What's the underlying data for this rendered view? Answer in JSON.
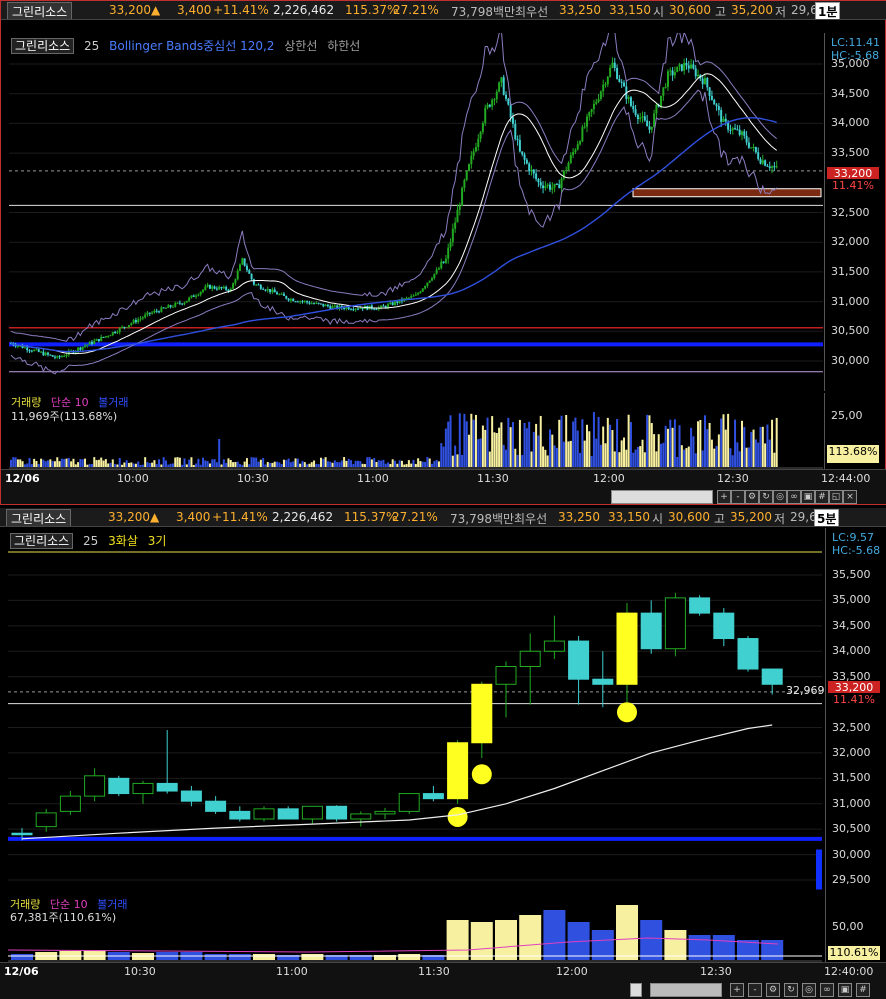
{
  "quote": {
    "symbol": "그린리소스",
    "price": "33,200",
    "arrow": "▲",
    "change": "3,400",
    "change_pct": "+11.41%",
    "volume": "2,226,462",
    "vol_ratio": "115.37%",
    "turnover": "27.21%",
    "amount": "73,798백만",
    "best_label": "최우선",
    "ask": "33,250",
    "bid": "33,150",
    "open_label": "시",
    "open": "30,600",
    "high_label": "고",
    "high": "35,200",
    "low_label": "저",
    "low": "29,6"
  },
  "top_chart": {
    "timeframe": "1분",
    "legend": {
      "symbol": "그린리소스",
      "period": "25",
      "indicator": "Bollinger Bands",
      "mid": "중심선 120,2",
      "upper": "상한선",
      "lower": "하한선"
    },
    "lc": "LC:11.41",
    "hc": "HC:-5.68",
    "y_ticks": [
      "35,000",
      "34,500",
      "34,000",
      "33,500",
      "32,500",
      "32,000",
      "31,500",
      "31,000",
      "30,500",
      "30,000"
    ],
    "price_tag": "33,200",
    "pct_tag": "11.41%",
    "volume_legend": {
      "label": "거래량",
      "ma": "단순 10",
      "extra": "볼거래",
      "value": "11,969주(113.68%)"
    },
    "vol_axis": "25,00",
    "vol_tag": "113.68%",
    "x_ticks": [
      "12/06",
      "10:00",
      "10:30",
      "11:00",
      "11:30",
      "12:00",
      "12:30",
      "12:44:00"
    ]
  },
  "bottom_chart": {
    "timeframe": "5분",
    "legend": {
      "symbol": "그린리소스",
      "period": "25",
      "pattern": "3화살",
      "count": "3기"
    },
    "lc": "LC:9.57",
    "hc": "HC:-5.68",
    "y_ticks": [
      "35,500",
      "35,000",
      "34,500",
      "34,000",
      "33,500",
      "32,500",
      "32,000",
      "31,500",
      "31,000",
      "30,500",
      "30,000",
      "29,500"
    ],
    "price_tag": "33,200",
    "pct_tag": "11.41%",
    "line_label": "32,969",
    "volume_legend": {
      "label": "거래량",
      "ma": "단순 10",
      "extra": "볼거래",
      "value": "67,381주(110.61%)"
    },
    "vol_axis": "50,00",
    "vol_tag": "110.61%",
    "x_ticks": [
      "12/06",
      "10:30",
      "11:00",
      "11:30",
      "12:00",
      "12:30",
      "12:40:00"
    ]
  },
  "candles5": [
    {
      "o": 30420,
      "h": 30520,
      "l": 30280,
      "c": 30400
    },
    {
      "o": 30550,
      "h": 30900,
      "l": 30450,
      "c": 30820
    },
    {
      "o": 30850,
      "h": 31250,
      "l": 30780,
      "c": 31150
    },
    {
      "o": 31150,
      "h": 31700,
      "l": 31050,
      "c": 31550
    },
    {
      "o": 31500,
      "h": 31550,
      "l": 31150,
      "c": 31200
    },
    {
      "o": 31200,
      "h": 31450,
      "l": 31000,
      "c": 31400
    },
    {
      "o": 31400,
      "h": 32450,
      "l": 31200,
      "c": 31250
    },
    {
      "o": 31250,
      "h": 31350,
      "l": 30950,
      "c": 31050
    },
    {
      "o": 31050,
      "h": 31150,
      "l": 30800,
      "c": 30850
    },
    {
      "o": 30850,
      "h": 30950,
      "l": 30650,
      "c": 30700
    },
    {
      "o": 30700,
      "h": 30950,
      "l": 30650,
      "c": 30900
    },
    {
      "o": 30900,
      "h": 30950,
      "l": 30700,
      "c": 30700
    },
    {
      "o": 30700,
      "h": 30950,
      "l": 30600,
      "c": 30950
    },
    {
      "o": 30950,
      "h": 30970,
      "l": 30650,
      "c": 30700
    },
    {
      "o": 30700,
      "h": 30850,
      "l": 30550,
      "c": 30800
    },
    {
      "o": 30800,
      "h": 30920,
      "l": 30700,
      "c": 30850
    },
    {
      "o": 30850,
      "h": 31200,
      "l": 30800,
      "c": 31200
    },
    {
      "o": 31200,
      "h": 31350,
      "l": 31050,
      "c": 31100
    },
    {
      "o": 31100,
      "h": 32250,
      "l": 31000,
      "c": 32200
    },
    {
      "o": 32200,
      "h": 33400,
      "l": 31900,
      "c": 33350
    },
    {
      "o": 33350,
      "h": 33800,
      "l": 32700,
      "c": 33700
    },
    {
      "o": 33700,
      "h": 34350,
      "l": 32950,
      "c": 34000
    },
    {
      "o": 34000,
      "h": 34700,
      "l": 33850,
      "c": 34200
    },
    {
      "o": 34200,
      "h": 34300,
      "l": 32950,
      "c": 33450
    },
    {
      "o": 33450,
      "h": 34000,
      "l": 32900,
      "c": 33350
    },
    {
      "o": 33350,
      "h": 34950,
      "l": 33000,
      "c": 34750
    },
    {
      "o": 34750,
      "h": 35000,
      "l": 33950,
      "c": 34050
    },
    {
      "o": 34050,
      "h": 35150,
      "l": 33900,
      "c": 35050
    },
    {
      "o": 35050,
      "h": 35100,
      "l": 34700,
      "c": 34750
    },
    {
      "o": 34750,
      "h": 34850,
      "l": 34100,
      "c": 34250
    },
    {
      "o": 34250,
      "h": 34300,
      "l": 33600,
      "c": 33650
    },
    {
      "o": 33650,
      "h": 33650,
      "l": 33150,
      "c": 33350
    }
  ],
  "vol5": [
    6,
    8,
    9,
    10,
    8,
    7,
    8,
    8,
    6,
    6,
    6,
    5,
    6,
    5,
    5,
    5,
    6,
    5,
    40,
    38,
    40,
    45,
    50,
    38,
    30,
    55,
    40,
    30,
    25,
    25,
    20,
    20
  ],
  "vol5_types": [
    "b",
    "y",
    "y",
    "y",
    "b",
    "y",
    "b",
    "b",
    "b",
    "b",
    "y",
    "b",
    "y",
    "b",
    "b",
    "y",
    "y",
    "b",
    "y",
    "y",
    "y",
    "y",
    "b",
    "b",
    "b",
    "y",
    "b",
    "y",
    "b",
    "b",
    "b",
    "b"
  ],
  "markers": [
    {
      "i": 18,
      "price": 30740
    },
    {
      "i": 19,
      "price": 31580
    },
    {
      "i": 25,
      "price": 32800
    }
  ]
}
